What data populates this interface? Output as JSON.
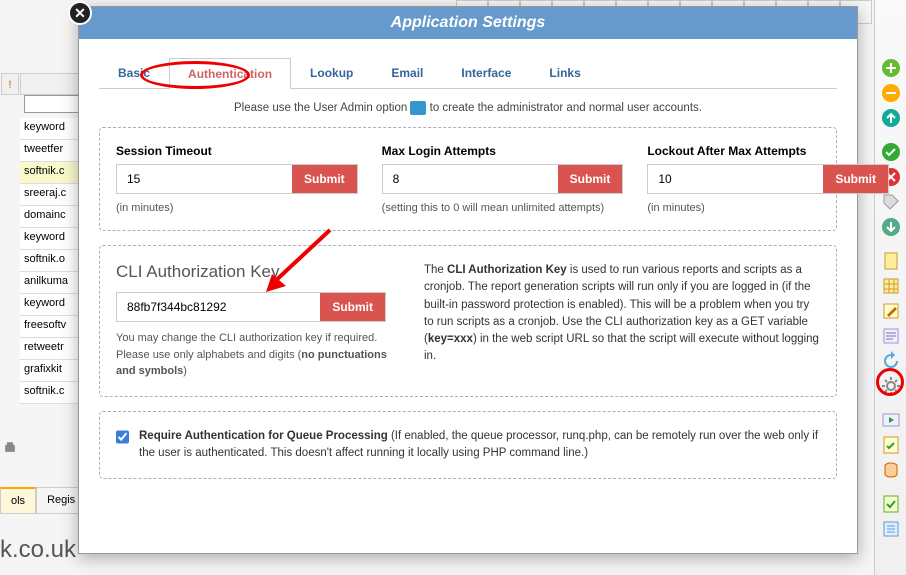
{
  "header": {
    "title": "Application Settings"
  },
  "tabs": {
    "basic": "Basic",
    "authentication": "Authentication",
    "lookup": "Lookup",
    "email": "Email",
    "interface": "Interface",
    "links": "Links"
  },
  "admin_note": {
    "pre": "Please use the User Admin option ",
    "post": " to create the administrator and normal user accounts."
  },
  "session": {
    "label": "Session Timeout",
    "value": "15",
    "submit": "Submit",
    "hint": "(in minutes)"
  },
  "maxlogin": {
    "label": "Max Login Attempts",
    "value": "8",
    "submit": "Submit",
    "hint": "(setting this to 0 will mean unlimited attempts)"
  },
  "lockout": {
    "label": "Lockout After Max Attempts",
    "value": "10",
    "submit": "Submit",
    "hint": "(in minutes)"
  },
  "cli": {
    "title": "CLI Authorization Key",
    "value": "88fb7f344bc81292",
    "submit": "Submit",
    "hint_a": "You may change the CLI authorization key if required. Please use only alphabets and digits (",
    "hint_b": "no punctuations and symbols",
    "hint_c": ")",
    "desc_a": "The ",
    "desc_b": "CLI Authorization Key",
    "desc_c": " is used to run various reports and scripts as a cronjob. The report generation scripts will run only if you are logged in (if the built-in password protection is enabled). This will be a problem when you try to run scripts as a cronjob. Use the CLI authorization key as a GET variable (",
    "desc_d": "key=xxx",
    "desc_e": ") in the web script URL so that the script will execute without logging in."
  },
  "queue": {
    "bold": "Require Authentication for Queue Processing",
    "rest": " (If enabled, the queue processor, runq.php, can be remotely run over the web only if the user is authenticated. This doesn't affect running it locally using PHP command line.)"
  },
  "bg_rows": [
    "keyword",
    "tweetfer",
    "softnik.c",
    "sreeraj.c",
    "domainc",
    "keyword",
    "softnik.o",
    "anilkuma",
    "keyword",
    "freesoftv",
    "retweetr",
    "grafixkit",
    "softnik.c"
  ],
  "footer_tabs": {
    "active": "ols",
    "next": "Regis"
  },
  "bg_domain": "k.co.uk"
}
